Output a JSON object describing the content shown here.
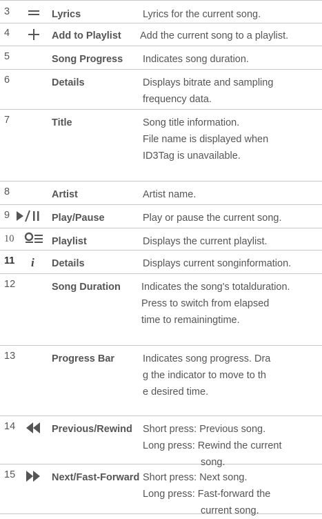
{
  "rows": [
    {
      "num": "3",
      "icon": "lyrics-icon",
      "name": [
        "Lyrics"
      ],
      "desc": [
        "Lyrics for the current song."
      ]
    },
    {
      "num": "4",
      "icon": "add-icon",
      "name": [
        "Add to Playlist"
      ],
      "desc": [
        "Add the current song to a playlist."
      ]
    },
    {
      "num": "5",
      "icon": "",
      "name": [
        "Song Progress"
      ],
      "desc": [
        "Indicates song duration."
      ]
    },
    {
      "num": "6",
      "icon": "",
      "name": [
        "Details"
      ],
      "desc": [
        "Displays bitrate and sampling",
        "frequency data."
      ]
    },
    {
      "num": "7",
      "icon": "",
      "name": [
        "Title"
      ],
      "desc": [
        "Song title information.",
        "File name is displayed when",
        "ID3Tag is unavailable."
      ]
    },
    {
      "num": "8",
      "icon": "",
      "name": [
        "Artist"
      ],
      "desc": [
        "Artist name."
      ]
    },
    {
      "num": "9",
      "icon": "play-pause-icon",
      "name": [
        "Play/Pause"
      ],
      "desc": [
        "Play or pause the current song."
      ]
    },
    {
      "num": "10",
      "icon": "playlist-icon",
      "name": [
        "Playlist"
      ],
      "desc": [
        "Displays the current playlist."
      ]
    },
    {
      "num": "11",
      "icon": "info-icon",
      "name": [
        "Details"
      ],
      "desc": [
        "Displays current songinformation."
      ]
    },
    {
      "num": "12",
      "icon": "",
      "name": [
        "Song Duration"
      ],
      "desc": [
        "Indicates the song's totalduration.",
        "Press to switch from elapsed",
        "time to remainingtime."
      ]
    },
    {
      "num": "13",
      "icon": "",
      "name": [
        "Progress Bar"
      ],
      "desc": [
        "Indicates song progress.  Dra",
        "g the indicator to move to  th",
        "e desired time."
      ]
    },
    {
      "num": "14",
      "icon": "rewind-icon",
      "name": [
        "Previous/",
        "Rewind"
      ],
      "desc": [
        "Short press: Previous song.",
        "Long press: Rewind the current",
        "song."
      ]
    },
    {
      "num": "15",
      "icon": "fast-forward-icon",
      "name": [
        "Next/",
        "Fast-Forward"
      ],
      "desc": [
        "Short press: Next song.",
        "Long press: Fast-forward the",
        "current song."
      ]
    }
  ]
}
